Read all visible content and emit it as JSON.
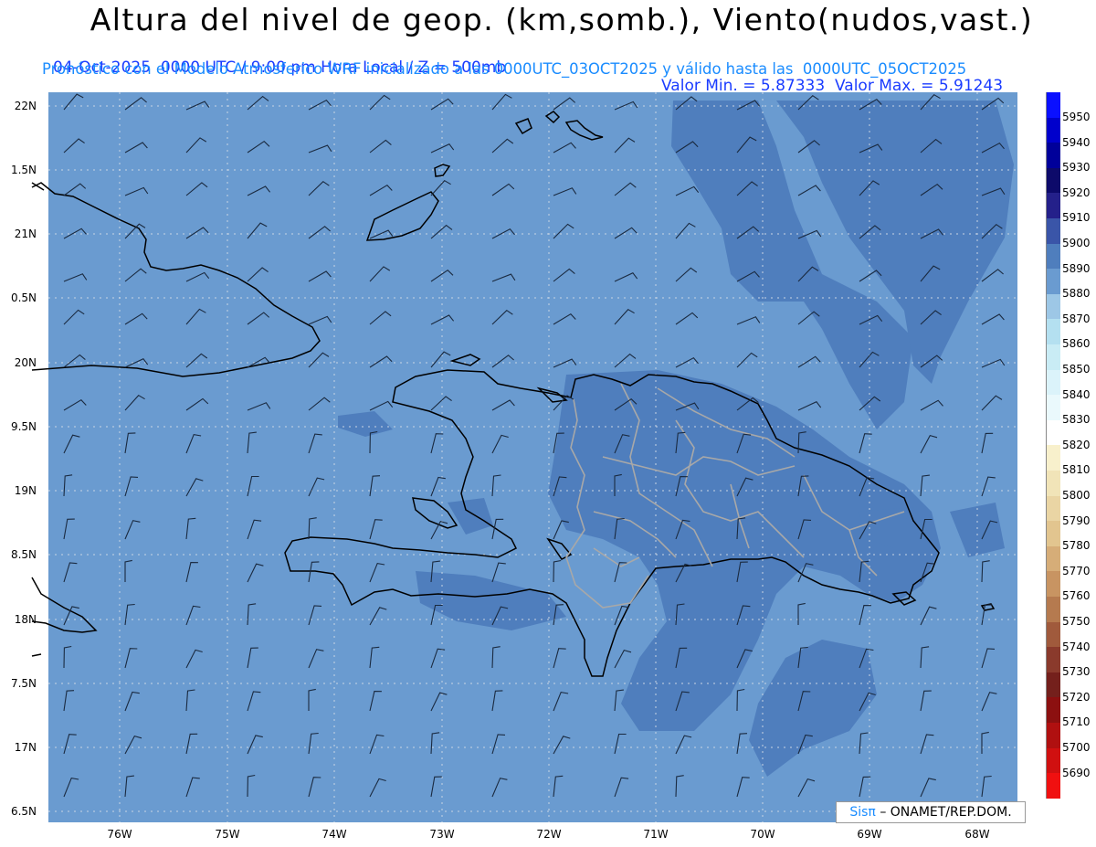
{
  "title": "Altura del nivel de geop. (km,somb.), Viento(nudos,vast.)",
  "subtitle_left": "04-Oct-2025  0000 UTC / 9:00 pm Hora Local / Z = 500mb",
  "subtitle_right": "Valor Min. = 5.87333  Valor Max. = 5.91243",
  "subtitle2": "Pronóstico con el Modelo Atmosferico WRF inicializado a las 0000UTC_03OCT2025 y válido hasta las  0000UTC_05OCT2025",
  "lat_labels": [
    "22N",
    "1.5N",
    "21N",
    "0.5N",
    "20N",
    "9.5N",
    "19N",
    "8.5N",
    "18N",
    "7.5N",
    "17N",
    "6.5N"
  ],
  "lon_labels": [
    "76W",
    "75W",
    "74W",
    "73W",
    "72W",
    "71W",
    "70W",
    "69W",
    "68W"
  ],
  "colorbar": {
    "labels": [
      "5950",
      "5940",
      "5930",
      "5920",
      "5910",
      "5900",
      "5890",
      "5880",
      "5870",
      "5860",
      "5850",
      "5840",
      "5830",
      "5820",
      "5810",
      "5800",
      "5790",
      "5780",
      "5770",
      "5760",
      "5750",
      "5740",
      "5730",
      "5720",
      "5710",
      "5700",
      "5690"
    ],
    "colors": [
      "#0a10ff",
      "#0000cc",
      "#00009a",
      "#0d0a6a",
      "#24208a",
      "#3a55a8",
      "#4f7ebd",
      "#6a9bd0",
      "#9dc7e6",
      "#b4e0f0",
      "#c9ecf5",
      "#dbf3fa",
      "#eaf9fc",
      "#ffffff",
      "#f8f0cc",
      "#f1e4b8",
      "#ead5a4",
      "#e2c58f",
      "#d6ad78",
      "#c89462",
      "#b57a4f",
      "#a05a3c",
      "#8a3a2c",
      "#74201c",
      "#8c1010",
      "#b01010",
      "#d01010",
      "#f01010"
    ]
  },
  "logo_prefix": "Sisπ",
  "logo_text": "– ONAMET/REP.DOM.",
  "colors": {
    "field_base": "#6a9bd0",
    "field_dark": "#4f7ebd",
    "coast": "#000000",
    "borders": "#a8a8a8"
  }
}
